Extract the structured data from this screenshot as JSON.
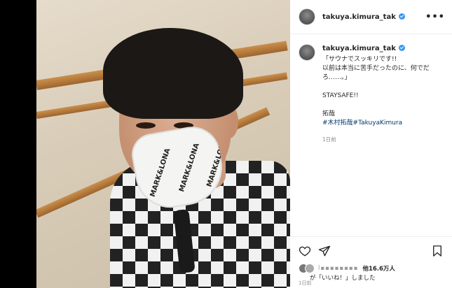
{
  "post": {
    "username": "takuya.kimura_tak",
    "caption_lines": [
      "「サウナでスッキリです!!",
      "以前は本当に苦手だったのに、何でだ",
      "ろ……。」",
      "STAYSAFE!!",
      "拓哉"
    ],
    "hashtags": "#木村拓哉#TakuyaKimura",
    "caption_time": "1日前",
    "mask_text": "MARK&LONA"
  },
  "likes": {
    "user": "l▪▪▪▪▪▪▪▪",
    "others": "他16.6万人",
    "line2": "が「いいね！」しました"
  },
  "bottom_time": "1日前",
  "icons": {
    "more": "more-icon",
    "heart": "heart-icon",
    "send": "send-icon",
    "bookmark": "bookmark-icon",
    "verified": "verified-badge-icon"
  }
}
